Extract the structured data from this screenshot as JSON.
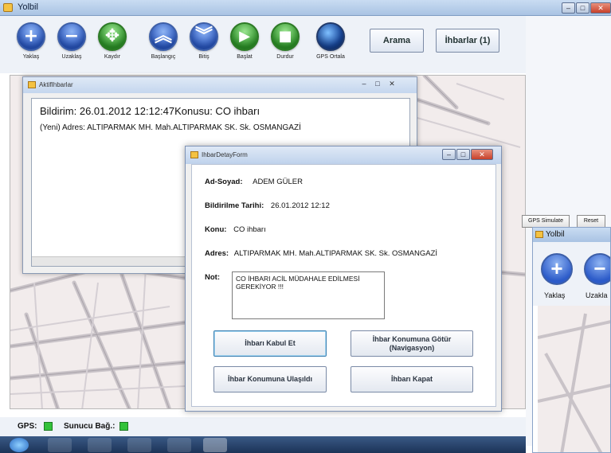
{
  "main_window": {
    "title": "Yolbil"
  },
  "toolbar": {
    "buttons": [
      {
        "id": "zoom-in",
        "label": "Yaklaş",
        "glyph": "+"
      },
      {
        "id": "zoom-out",
        "label": "Uzaklaş",
        "glyph": "−"
      },
      {
        "id": "pan",
        "label": "Kaydır",
        "glyph": "✥"
      },
      {
        "id": "start",
        "label": "Başlangıç",
        "glyph": "︽"
      },
      {
        "id": "end",
        "label": "Bitiş",
        "glyph": "︾"
      },
      {
        "id": "begin",
        "label": "Başlat",
        "glyph": "▶"
      },
      {
        "id": "stop",
        "label": "Durdur",
        "glyph": "■"
      },
      {
        "id": "gps-center",
        "label": "GPS Ortala",
        "glyph": ""
      }
    ],
    "search_label": "Arama",
    "reports_label": "İhbarlar (1)"
  },
  "right_panel": {
    "gps_simulate": "GPS Simulate",
    "reset": "Reset"
  },
  "second_window": {
    "title": "Yolbil",
    "zoom_in_label": "Yaklaş",
    "zoom_out_label": "Uzakla"
  },
  "status": {
    "gps_label": "GPS:",
    "server_label": "Sunucu Bağ.:"
  },
  "aktif_window": {
    "title": "AktifIhbarlar",
    "line1": "Bildirim: 26.01.2012 12:12:47Konusu: CO ihbarı",
    "line2": "(Yeni) Adres: ALTIPARMAK MH. Mah.ALTIPARMAK SK. Sk. OSMANGAZİ"
  },
  "detay_form": {
    "title": "IhbarDetayForm",
    "name_key": "Ad-Soyad:",
    "name_val": "ADEM GÜLER",
    "date_key": "Bildirilme Tarihi:",
    "date_val": "26.01.2012 12:12",
    "subject_key": "Konu:",
    "subject_val": "CO ihbarı",
    "address_key": "Adres:",
    "address_val": "ALTIPARMAK MH. Mah.ALTIPARMAK SK. Sk. OSMANGAZİ",
    "note_key": "Not:",
    "note_val": "CO İHBARI ACİL MÜDAHALE EDİLMESİ GEREKİYOR !!!",
    "accept_button": "İhbarı Kabul Et",
    "navigate_button": "İhbar Konumuna Götür (Navigasyon)",
    "arrived_button": "İhbar Konumuna Ulaşıldı",
    "close_button": "İhbarı Kapat"
  },
  "colors": {
    "titlebar": "#b9cfea",
    "accent_blue": "#2c5bc9",
    "accent_green": "#33c23a"
  }
}
